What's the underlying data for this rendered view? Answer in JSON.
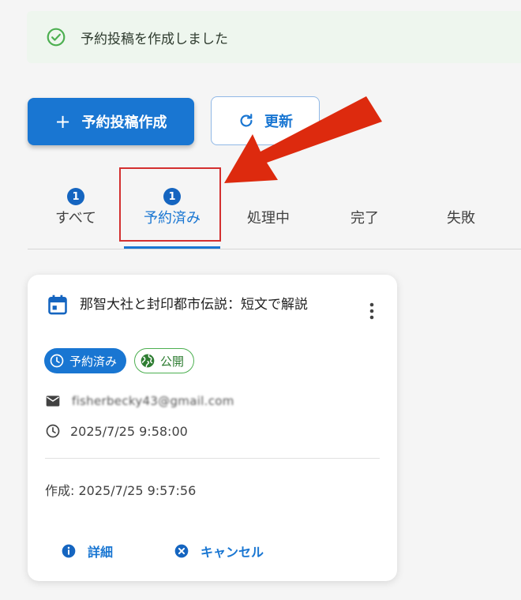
{
  "alert": {
    "message": "予約投稿を作成しました",
    "icon": "check-circle-icon"
  },
  "toolbar": {
    "create_icon": "+",
    "create_label": "予約投稿作成",
    "refresh_label": "更新"
  },
  "tabs": [
    {
      "label": "すべて",
      "badge": "1"
    },
    {
      "label": "予約済み",
      "badge": "1"
    },
    {
      "label": "処理中",
      "badge": ""
    },
    {
      "label": "完了",
      "badge": ""
    },
    {
      "label": "失敗",
      "badge": ""
    }
  ],
  "card": {
    "title": "那智大社と封印都市伝説：短文で解説",
    "status_chip": "予約済み",
    "visibility_chip": "公開",
    "email": "fisherbecky43@gmail.com",
    "scheduled_at": "2025/7/25 9:58:00",
    "created": "作成: 2025/7/25 9:57:56",
    "detail_label": "詳細",
    "cancel_label": "キャンセル"
  },
  "colors": {
    "primary": "#1976d2",
    "success": "#4caf50",
    "annotation": "#d32f2f"
  }
}
